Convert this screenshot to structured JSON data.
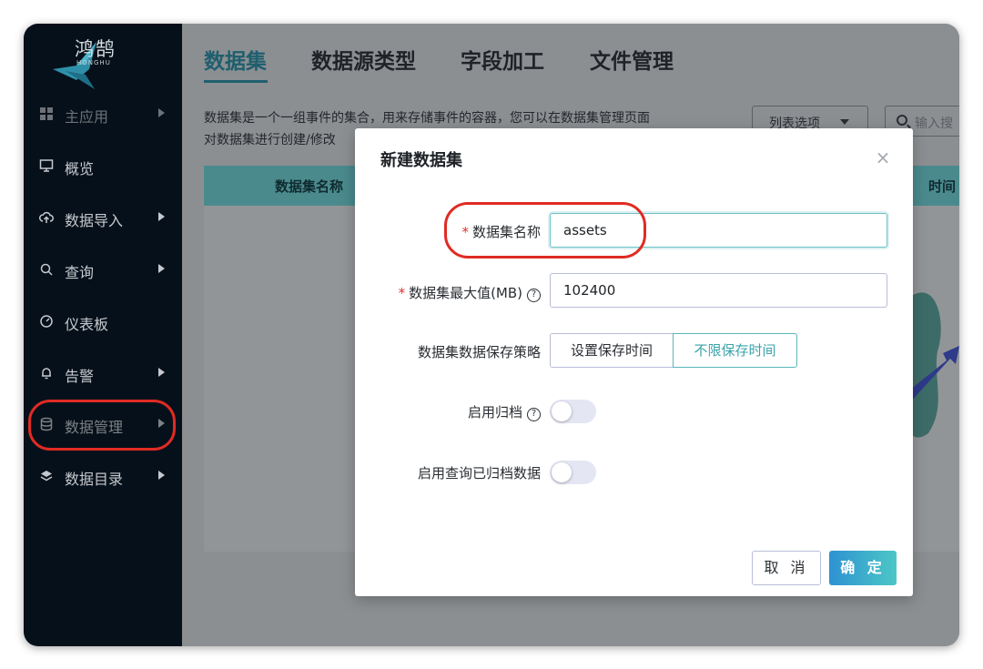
{
  "app": {
    "name": "鸿鹄",
    "sub": "HONGHU"
  },
  "sidebar": {
    "items": [
      {
        "label": "主应用",
        "icon": "grid-icon",
        "arrow": true
      },
      {
        "label": "概览",
        "icon": "monitor-icon",
        "arrow": false
      },
      {
        "label": "数据导入",
        "icon": "upload-cloud-icon",
        "arrow": true
      },
      {
        "label": "查询",
        "icon": "search-icon",
        "arrow": true
      },
      {
        "label": "仪表板",
        "icon": "gauge-icon",
        "arrow": false
      },
      {
        "label": "告警",
        "icon": "bell-icon",
        "arrow": true
      },
      {
        "label": "数据管理",
        "icon": "database-icon",
        "arrow": true
      },
      {
        "label": "数据目录",
        "icon": "layers-icon",
        "arrow": true
      }
    ]
  },
  "tabs": [
    "数据集",
    "数据源类型",
    "字段加工",
    "文件管理"
  ],
  "main": {
    "description_line1": "数据集是一个一组事件的集合，用来存储事件的容器，您可以在数据集管理页面",
    "description_line2": "对数据集进行创建/修改",
    "list_options": "列表选项",
    "search_placeholder": "输入搜",
    "col_name": "数据集名称",
    "col_time": "时间"
  },
  "modal": {
    "title": "新建数据集",
    "close": "×",
    "name_label": "数据集名称",
    "name_value": "assets",
    "max_label": "数据集最大值(MB)",
    "max_value": "102400",
    "policy_label": "数据集数据保存策略",
    "policy_options": [
      "设置保存时间",
      "不限保存时间"
    ],
    "archive_label": "启用归档",
    "query_archive_label": "启用查询已归档数据",
    "cancel": "取 消",
    "ok": "确 定",
    "help_glyph": "?"
  },
  "colors": {
    "accent": "#3aa3ab",
    "highlight": "#e02b23",
    "sidebar_bg": "#06101a"
  }
}
